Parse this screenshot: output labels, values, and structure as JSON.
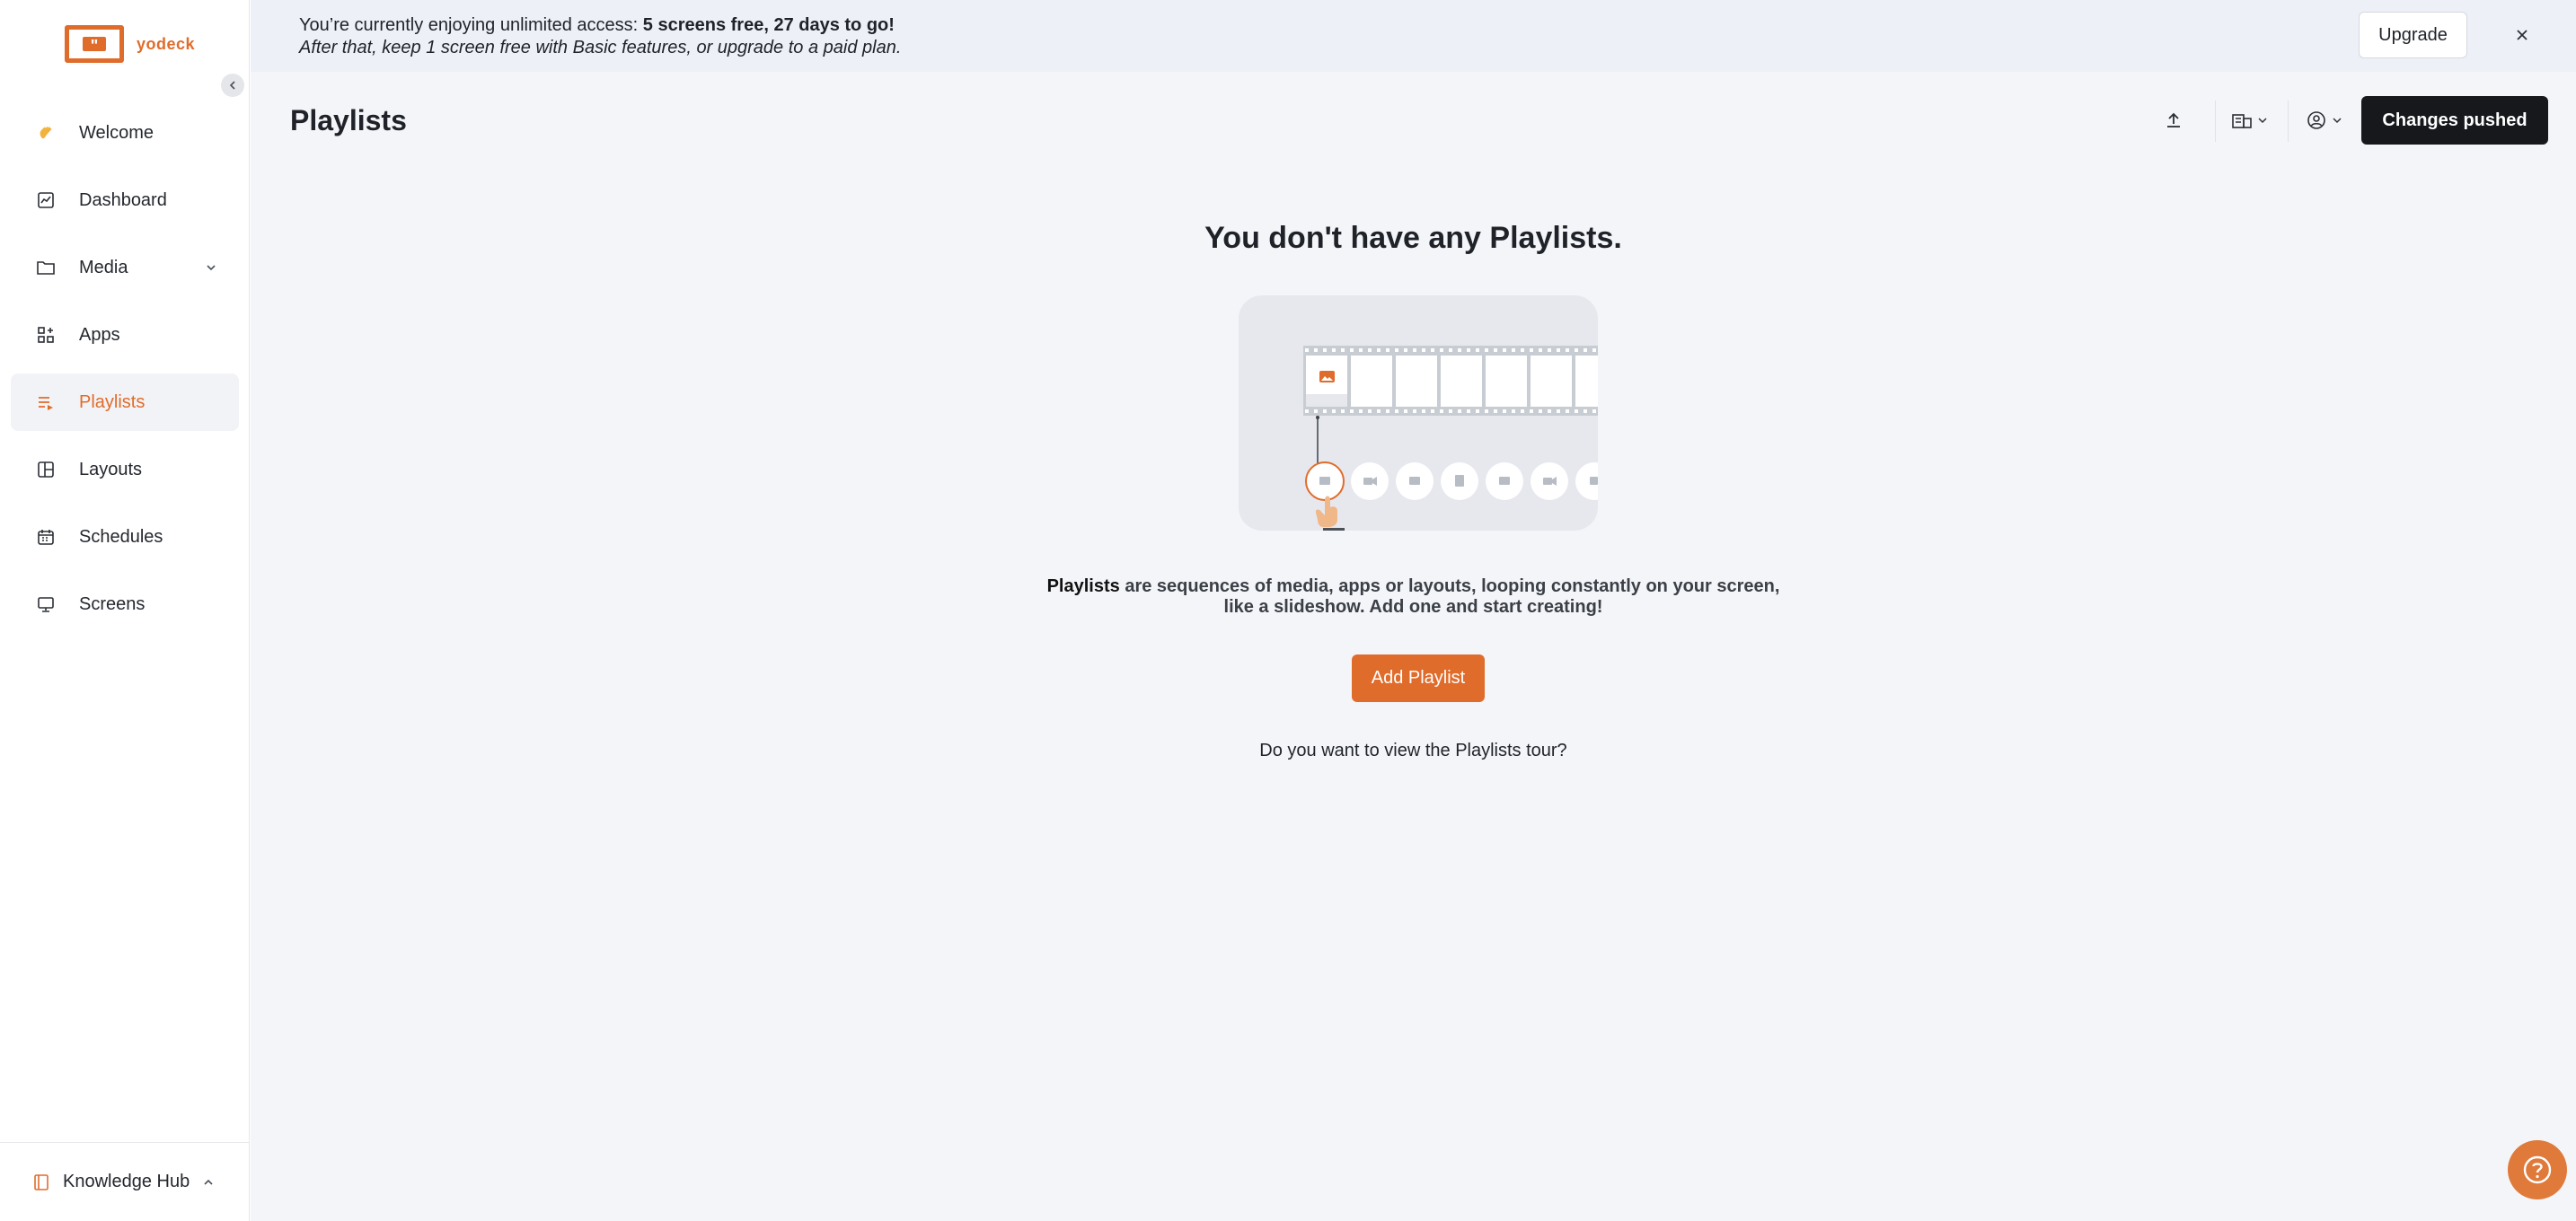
{
  "brand": {
    "name": "yodeck",
    "accent": "#e06c2b"
  },
  "sidebar": {
    "items": [
      {
        "label": "Welcome",
        "icon": "waving-hand-icon"
      },
      {
        "label": "Dashboard",
        "icon": "dashboard-chart-icon"
      },
      {
        "label": "Media",
        "icon": "folder-icon"
      },
      {
        "label": "Apps",
        "icon": "apps-grid-icon"
      },
      {
        "label": "Playlists",
        "icon": "playlist-icon",
        "active": true
      },
      {
        "label": "Layouts",
        "icon": "layout-icon"
      },
      {
        "label": "Schedules",
        "icon": "calendar-icon"
      },
      {
        "label": "Screens",
        "icon": "monitor-icon"
      }
    ],
    "footer": {
      "label": "Knowledge Hub",
      "icon": "book-icon"
    }
  },
  "banner": {
    "line1_prefix": "You’re currently enjoying unlimited access: ",
    "line1_bold": "5 screens free, 27 days to go!",
    "line2": "After that, keep 1 screen free with Basic features, or upgrade to a paid plan.",
    "upgrade_label": "Upgrade"
  },
  "header": {
    "title": "Playlists",
    "changes_label": "Changes pushed"
  },
  "empty_state": {
    "title": "You don't have any Playlists.",
    "desc_bold": "Playlists",
    "desc_rest": " are sequences of media, apps or layouts, looping constantly on your screen, like a slideshow. Add one and start creating!",
    "add_label": "Add Playlist",
    "tour_text": "Do you want to view the Playlists tour?"
  }
}
